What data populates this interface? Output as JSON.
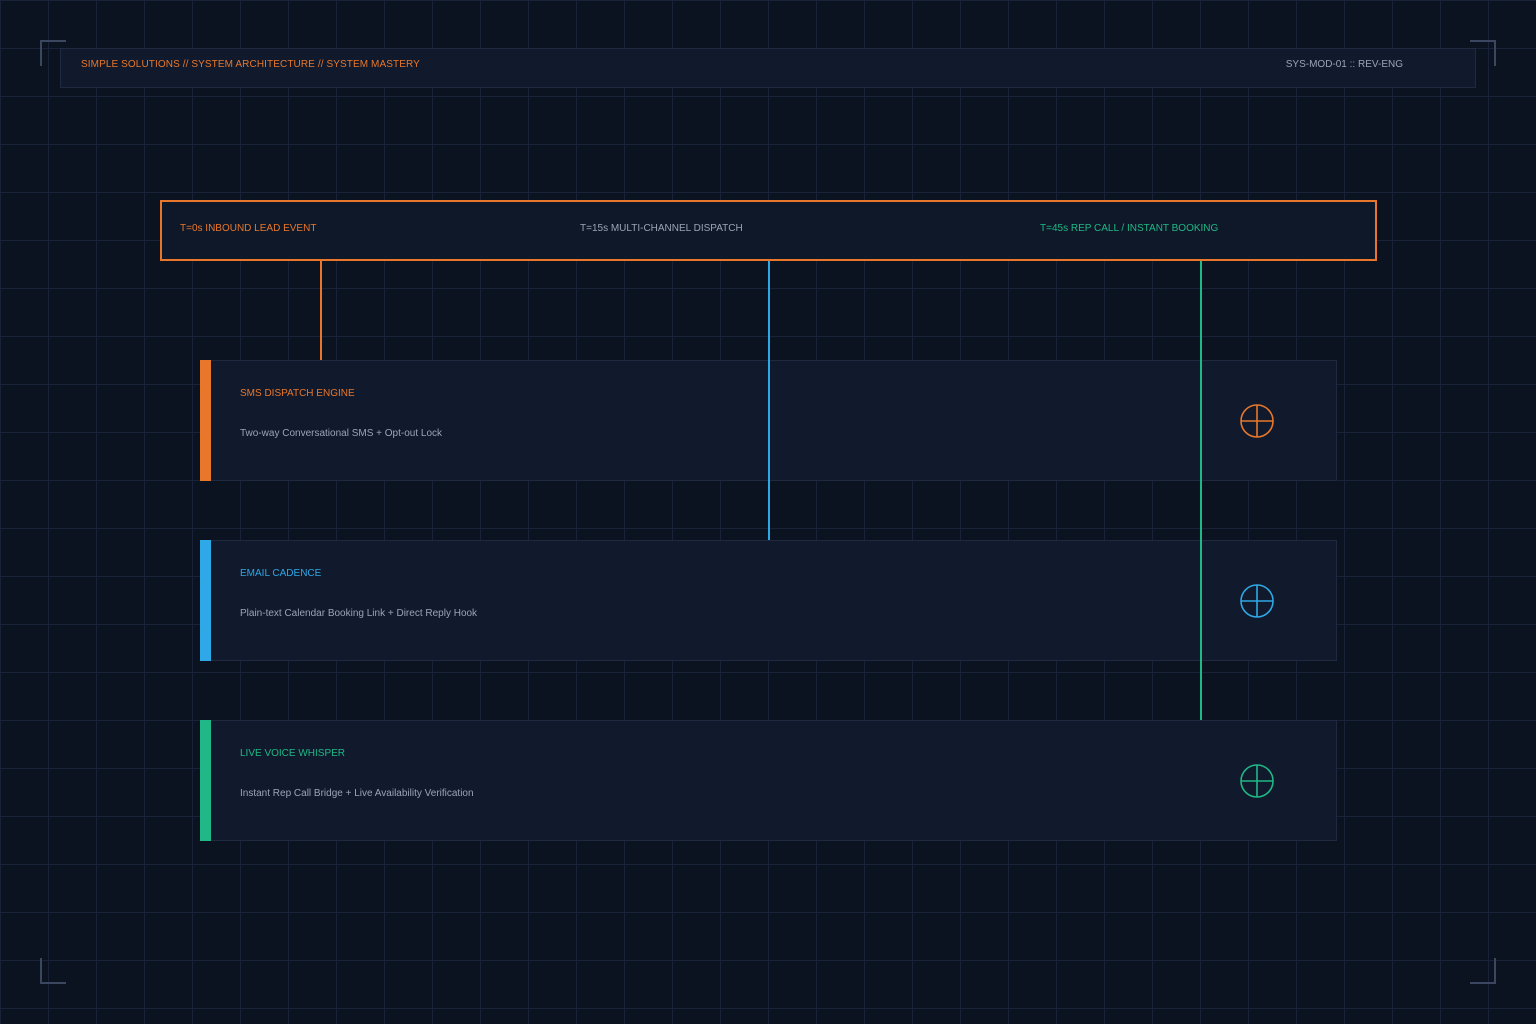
{
  "header": {
    "left_text": "SIMPLE SOLUTIONS // SYSTEM ARCHITECTURE // SYSTEM MASTERY",
    "right_text": "SYS-MOD-01 :: REV-ENG"
  },
  "timeline": {
    "stages": [
      {
        "label": "T=0s INBOUND LEAD EVENT",
        "color": "#e8772b"
      },
      {
        "label": "T=15s MULTI-CHANNEL DISPATCH",
        "color": "#9aa4b6"
      },
      {
        "label": "T=45s REP CALL / INSTANT BOOKING",
        "color": "#1fb886"
      }
    ]
  },
  "modules": [
    {
      "title": "SMS DISPATCH ENGINE",
      "description": "Two-way Conversational SMS + Opt-out Lock",
      "color": "#e8772b",
      "icon": "crosshair-icon"
    },
    {
      "title": "EMAIL CADENCE",
      "description": "Plain-text Calendar Booking Link + Direct Reply Hook",
      "color": "#2ea8e6",
      "icon": "crosshair-icon"
    },
    {
      "title": "LIVE VOICE WHISPER",
      "description": "Instant Rep Call Bridge + Live Availability Verification",
      "color": "#1fb886",
      "icon": "crosshair-icon"
    }
  ],
  "colors": {
    "background": "#0b1220",
    "panel": "#111a2c",
    "orange": "#e8772b",
    "blue": "#2ea8e6",
    "green": "#1fb886",
    "muted_text": "#9aa4b6"
  }
}
